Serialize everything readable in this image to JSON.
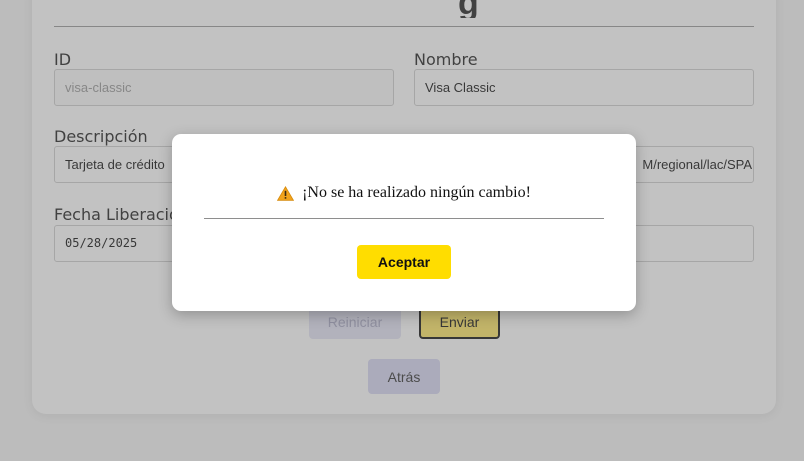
{
  "form": {
    "id_label": "ID",
    "id_value": "visa-classic",
    "name_label": "Nombre",
    "name_value": "Visa Classic",
    "description_label": "Descripción",
    "description_value": "Tarjeta de crédito",
    "link_value": "M/regional/lac/SPA",
    "release_date_label": "Fecha Liberación",
    "release_date_value": "05/28/2025"
  },
  "buttons": {
    "reset_label": "Reiniciar",
    "send_label": "Enviar",
    "back_label": "Atrás"
  },
  "dialog": {
    "message": "¡No se ha realizado ningún cambio!",
    "icon": "warning-icon",
    "accept_label": "Aceptar"
  },
  "colors": {
    "accent_yellow": "#ffdd00",
    "send_button": "#ffe766",
    "overlay": "#6e6e6e"
  }
}
